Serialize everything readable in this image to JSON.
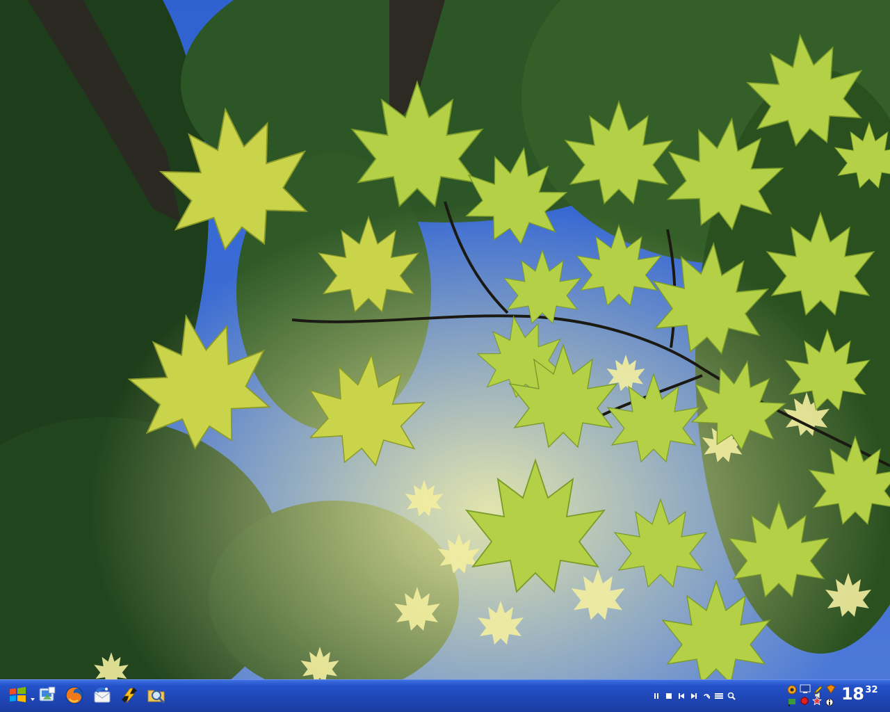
{
  "desktop": {
    "wallpaper": "maple-leaves-sky",
    "colors": {
      "sky": "#3f6fd6",
      "leaf_light": "#d8dd5a",
      "leaf_green": "#a6c83a",
      "foliage_dark": "#1f3d1a"
    }
  },
  "taskbar": {
    "color": "#2452c9",
    "quick_launch": [
      {
        "name": "start-button",
        "icon": "start-menu-icon"
      },
      {
        "name": "show-desktop-button",
        "icon": "desktop-icon"
      },
      {
        "name": "firefox-button",
        "icon": "firefox-icon"
      },
      {
        "name": "thunderbird-button",
        "icon": "thunderbird-icon"
      },
      {
        "name": "winamp-button",
        "icon": "lightning-icon"
      },
      {
        "name": "search-button",
        "icon": "magnifier-folder-icon"
      }
    ],
    "mini_controls": [
      "pause",
      "stop",
      "previous",
      "next",
      "repeat",
      "playlist",
      "search"
    ],
    "tray_icons": [
      "network-icon",
      "monitor-icon",
      "pencil-icon",
      "shield-icon",
      "flag-icon",
      "volume-icon",
      "record-icon",
      "star-icon",
      "info-icon"
    ],
    "clock": {
      "hours": "18",
      "minutes": "32"
    }
  }
}
